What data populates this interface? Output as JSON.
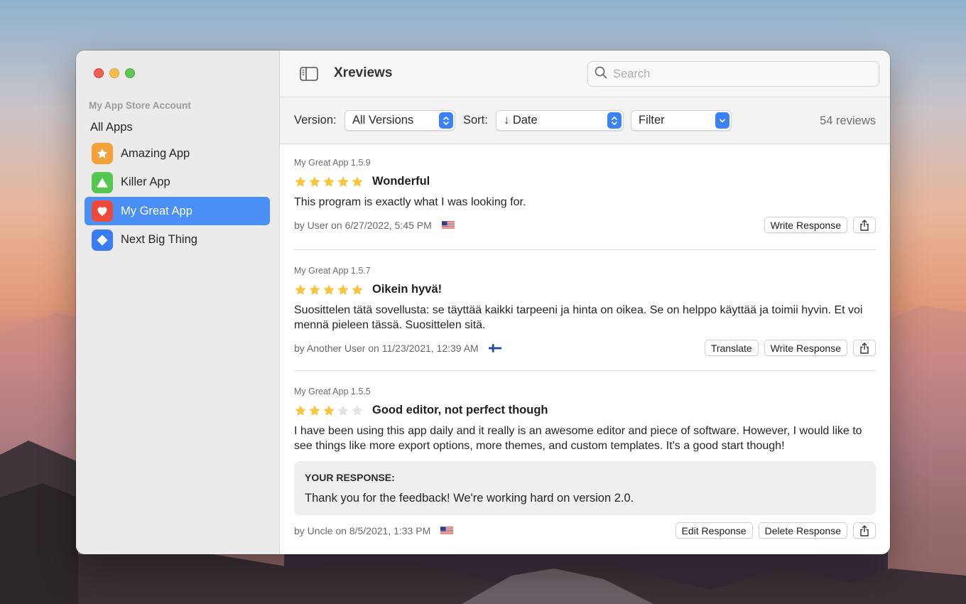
{
  "sidebar": {
    "section_title": "My App Store Account",
    "all_apps": "All Apps",
    "items": [
      {
        "label": "Amazing App",
        "icon": "star-icon",
        "color": "#f5a23a",
        "active": false
      },
      {
        "label": "Killer App",
        "icon": "triangle-icon",
        "color": "#55c64e",
        "active": false
      },
      {
        "label": "My Great App",
        "icon": "heart-icon",
        "color": "#ee4a3c",
        "active": true
      },
      {
        "label": "Next Big Thing",
        "icon": "diamond-icon",
        "color": "#3a7cf4",
        "active": false
      }
    ]
  },
  "header": {
    "title": "Xreviews",
    "search_placeholder": "Search"
  },
  "toolbar": {
    "version_label": "Version:",
    "version_value": "All Versions",
    "sort_label": "Sort:",
    "sort_value": "↓ Date",
    "filter_value": "Filter",
    "review_count": "54 reviews"
  },
  "reviews": [
    {
      "version": "My Great App 1.5.9",
      "rating": 5,
      "title": "Wonderful",
      "body": "This program is exactly what I was looking for.",
      "meta": "by User on 6/27/2022, 5:45 PM",
      "flag": "US",
      "buttons": [
        "Write Response"
      ]
    },
    {
      "version": "My Great App 1.5.7",
      "rating": 5,
      "title": "Oikein hyvä!",
      "body": "Suosittelen tätä sovellusta: se täyttää kaikki tarpeeni ja hinta on oikea. Se on helppo käyttää ja toimii hyvin. Et voi mennä pieleen tässä. Suosittelen sitä.",
      "meta": "by Another User on 11/23/2021, 12:39 AM",
      "flag": "FI",
      "buttons": [
        "Translate",
        "Write Response"
      ]
    },
    {
      "version": "My Great App 1.5.5",
      "rating": 3,
      "title": "Good editor, not perfect though",
      "body": "I have been using this app daily and it really is an awesome editor and piece of software. However, I would like to see things like more export options, more themes, and custom templates. It's a good start though!",
      "response_label": "YOUR RESPONSE:",
      "response_text": "Thank you for the feedback! We're working hard on version 2.0.",
      "meta": "by Uncle on 8/5/2021, 1:33 PM",
      "flag": "US",
      "buttons": [
        "Edit Response",
        "Delete Response"
      ]
    }
  ],
  "colors": {
    "accent": "#4a8ff5",
    "star_filled": "#f7c63e",
    "star_empty": "#e3e3e3"
  }
}
